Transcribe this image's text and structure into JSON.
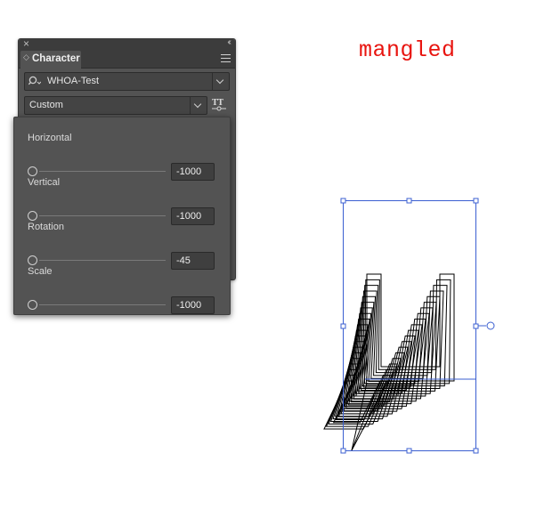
{
  "canvas": {
    "annotation": "mangled"
  },
  "panel": {
    "tab_label": "Character",
    "font_family": "WHOA-Test",
    "font_style": "Custom",
    "icons": [
      "close-icon",
      "collapse-icon",
      "panel-menu-icon",
      "search-icon",
      "chevron-down-icon",
      "variable-font-icon"
    ]
  },
  "variable_font_popup": {
    "controls": [
      {
        "label": "Horizontal",
        "value": "-1000"
      },
      {
        "label": "Vertical",
        "value": "-1000"
      },
      {
        "label": "Rotation",
        "value": "-45"
      },
      {
        "label": "Scale",
        "value": "-1000"
      }
    ]
  },
  "colors": {
    "annotation": "#e8140f",
    "panel_bg": "#535353",
    "selection": "#3b5fd1"
  }
}
